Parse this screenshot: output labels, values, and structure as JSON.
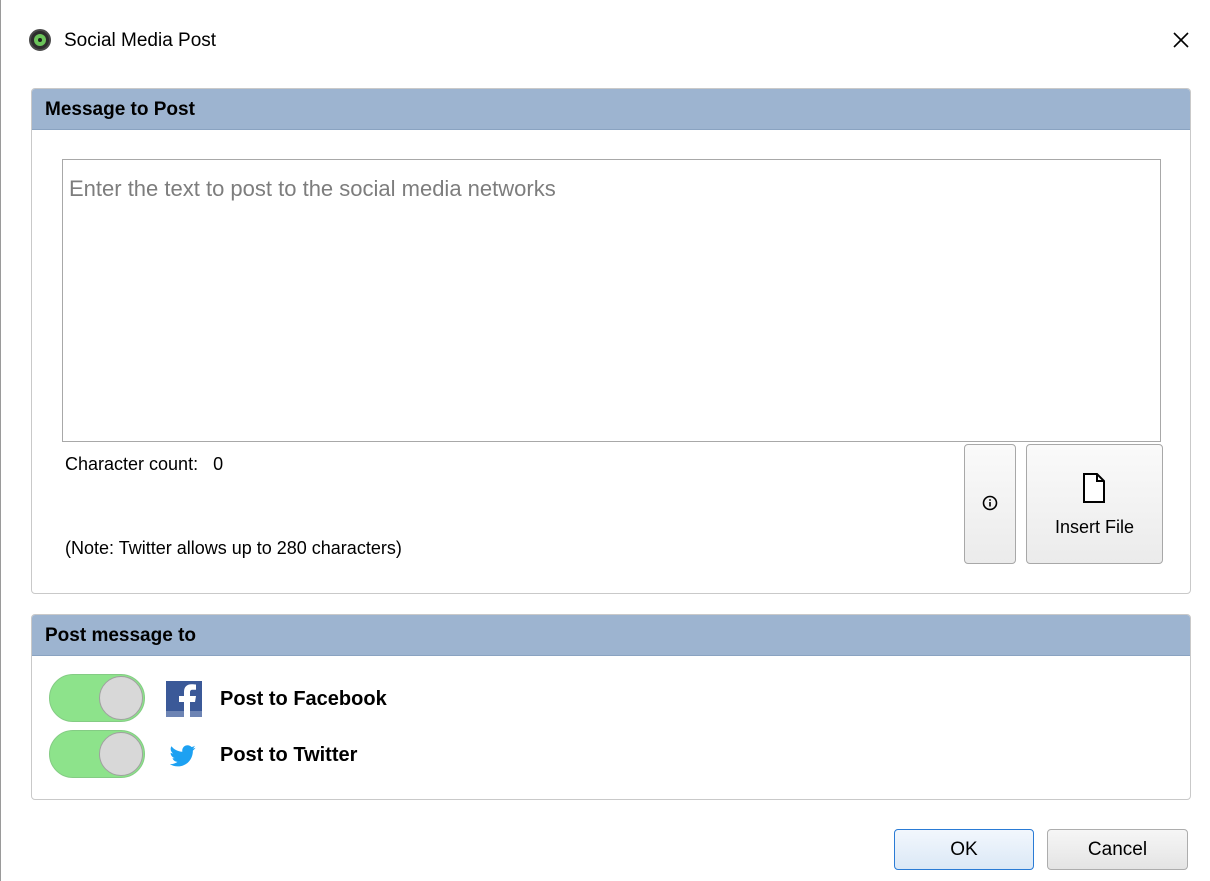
{
  "window": {
    "title": "Social Media Post"
  },
  "message_section": {
    "header": "Message to Post",
    "textarea_placeholder": "Enter the text to post to the social media networks",
    "textarea_value": "",
    "char_count_label": "Character count:",
    "char_count_value": "0",
    "note": "(Note: Twitter allows up to 280 characters)",
    "insert_file_label": "Insert File"
  },
  "post_section": {
    "header": "Post message to",
    "targets": [
      {
        "label": "Post to Facebook",
        "enabled": true,
        "icon": "facebook-icon"
      },
      {
        "label": "Post to Twitter",
        "enabled": true,
        "icon": "twitter-icon"
      }
    ]
  },
  "buttons": {
    "ok": "OK",
    "cancel": "Cancel"
  },
  "colors": {
    "section_header": "#9db4d0",
    "toggle_on": "#8de38b",
    "facebook": "#3b5998",
    "twitter": "#1da1f2",
    "ok_border": "#2a7bd5"
  }
}
